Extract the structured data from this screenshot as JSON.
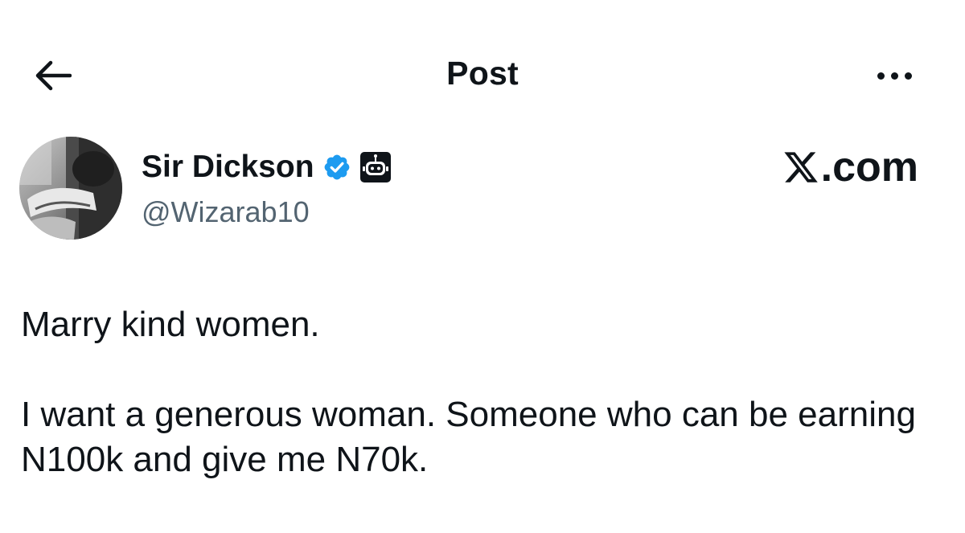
{
  "header": {
    "title": "Post",
    "back_icon": "arrow-left-icon",
    "more_icon": "more-horizontal-icon"
  },
  "author": {
    "name": "Sir Dickson",
    "handle": "@Wizarab10",
    "verified_icon": "verified-badge-icon",
    "verified_color": "#1d9bf0",
    "affiliate_icon": "robot-affiliate-icon"
  },
  "watermark": {
    "suffix": ".com",
    "icon": "x-logo-icon"
  },
  "post": {
    "paragraphs": [
      "Marry kind women.",
      "I want a generous woman. Someone who can be earning N100k and give me N70k."
    ]
  },
  "colors": {
    "text_primary": "#0f1419",
    "text_secondary": "#536471",
    "background": "#ffffff",
    "accent": "#1d9bf0"
  }
}
